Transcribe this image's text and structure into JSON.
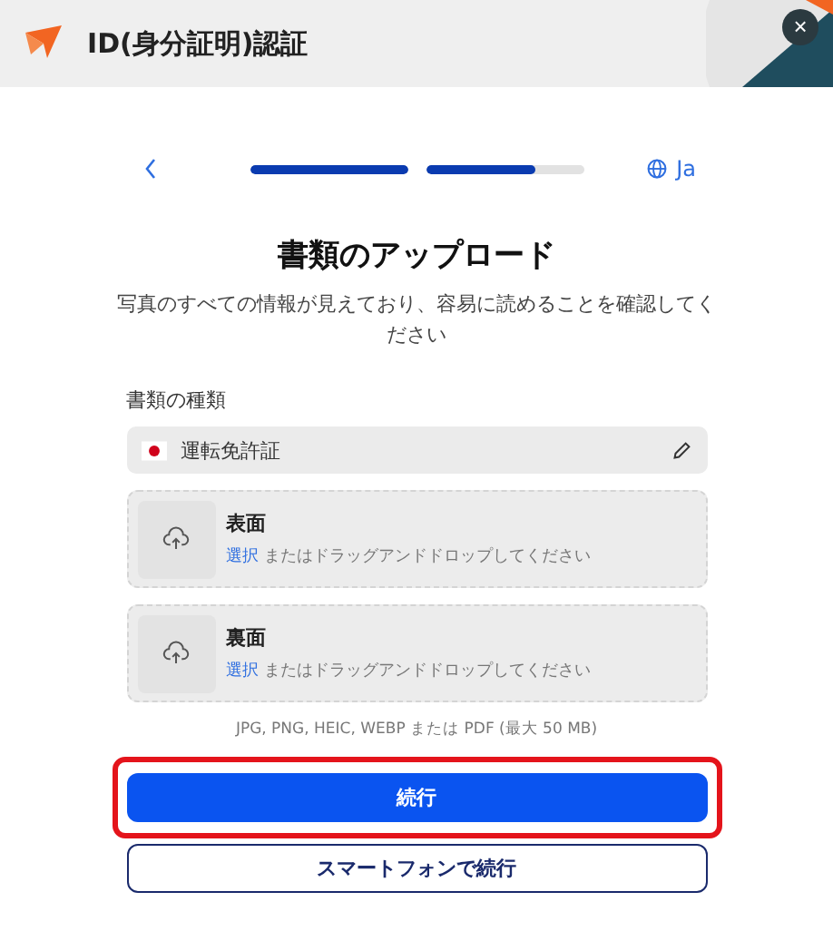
{
  "header": {
    "title": "ID(身分証明)認証",
    "close": "×"
  },
  "nav": {
    "language": "Ja"
  },
  "progress": [
    {
      "level": 1
    },
    {
      "level": 0.7
    }
  ],
  "heading": "書類のアップロード",
  "subtitle": "写真のすべての情報が見えており、容易に読めることを確認してください",
  "document_type": {
    "label": "書類の種類",
    "value": "運転免許証"
  },
  "uploads": [
    {
      "title": "表面",
      "link": "選択",
      "hint": "またはドラッグアンドドロップしてください"
    },
    {
      "title": "裏面",
      "link": "選択",
      "hint": "またはドラッグアンドドロップしてください"
    }
  ],
  "file_hint": "JPG, PNG, HEIC, WEBP または PDF (最大 50 MB)",
  "buttons": [
    {
      "label": "続行",
      "kind": "primary",
      "highlighted": true
    },
    {
      "label": "スマートフォンで続行",
      "kind": "outline",
      "highlighted": false
    }
  ]
}
